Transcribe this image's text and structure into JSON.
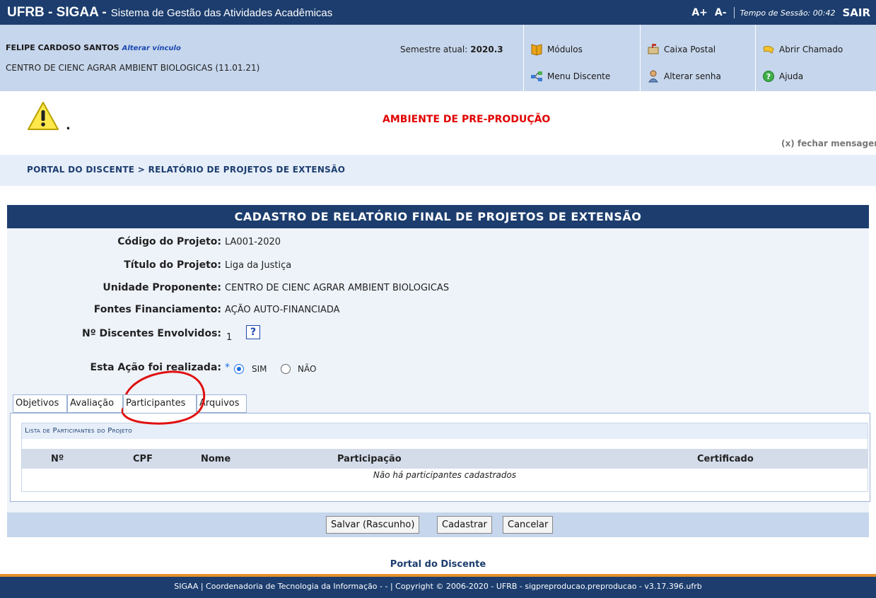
{
  "header": {
    "system_name": "UFRB - SIGAA -",
    "system_subtitle": "Sistema de Gestão das Atividades Acadêmicas",
    "font_increase": "A+",
    "font_decrease": "A-",
    "session_time": "Tempo de Sessão: 00:42",
    "logout": "SAIR"
  },
  "user": {
    "name": "FELIPE CARDOSO SANTOS",
    "change_link": "Alterar vínculo",
    "unit": "CENTRO DE CIENC AGRAR AMBIENT BIOLOGICAS (11.01.21)",
    "semester_label": "Semestre atual:",
    "semester": "2020.3"
  },
  "quick_links": {
    "modulos": "Módulos",
    "caixa_postal": "Caixa Postal",
    "abrir_chamado": "Abrir Chamado",
    "menu_discente": "Menu Discente",
    "alterar_senha": "Alterar senha",
    "ajuda": "Ajuda"
  },
  "warning": {
    "dot": ".",
    "message": "AMBIENTE DE PRE-PRODUÇÃO",
    "close": "(x) fechar mensagens"
  },
  "breadcrumb": "Portal do Discente > Relatório de Projetos de Extensão",
  "form": {
    "title": "CADASTRO DE RELATÓRIO FINAL DE PROJETOS DE EXTENSÃO",
    "fields": [
      {
        "label": "Código do Projeto:",
        "value": "LA001-2020"
      },
      {
        "label": "Título do Projeto:",
        "value": "Liga da Justiça"
      },
      {
        "label": "Unidade Proponente:",
        "value": "CENTRO DE CIENC AGRAR AMBIENT BIOLOGICAS"
      },
      {
        "label": "Fontes Financiamento:",
        "value": "AÇÃO AUTO-FINANCIADA"
      },
      {
        "label": "Nº Discentes Envolvidos:",
        "value": "1"
      }
    ],
    "help": "?",
    "realizada_label": "Esta Ação foi realizada:",
    "required_mark": "*",
    "option_sim": "SIM",
    "option_nao": "NÃO",
    "selected": "SIM"
  },
  "tabs": [
    "Objetivos",
    "Avaliação",
    "Participantes",
    "Arquivos"
  ],
  "active_tab": "Participantes",
  "participants": {
    "caption": "Lista de Participantes do Projeto",
    "columns": [
      "Nº",
      "CPF",
      "Nome",
      "Participação",
      "Certificado"
    ],
    "empty_message": "Não há participantes cadastrados"
  },
  "buttons": {
    "save_draft": "Salvar (Rascunho)",
    "submit": "Cadastrar",
    "cancel": "Cancelar"
  },
  "footer": {
    "portal_link": "Portal do Discente",
    "copyright": "SIGAA | Coordenadoria de Tecnologia da Informação - - | Copyright © 2006-2020 - UFRB - sigpreproducao.preproducao - v3.17.396.ufrb"
  },
  "colors": {
    "header_blue": "#1c3d6e",
    "info_bar": "#c6d6ec",
    "warning_red": "#e10000",
    "footer_accent": "#e4912b",
    "annotation_red": "#e01010"
  }
}
